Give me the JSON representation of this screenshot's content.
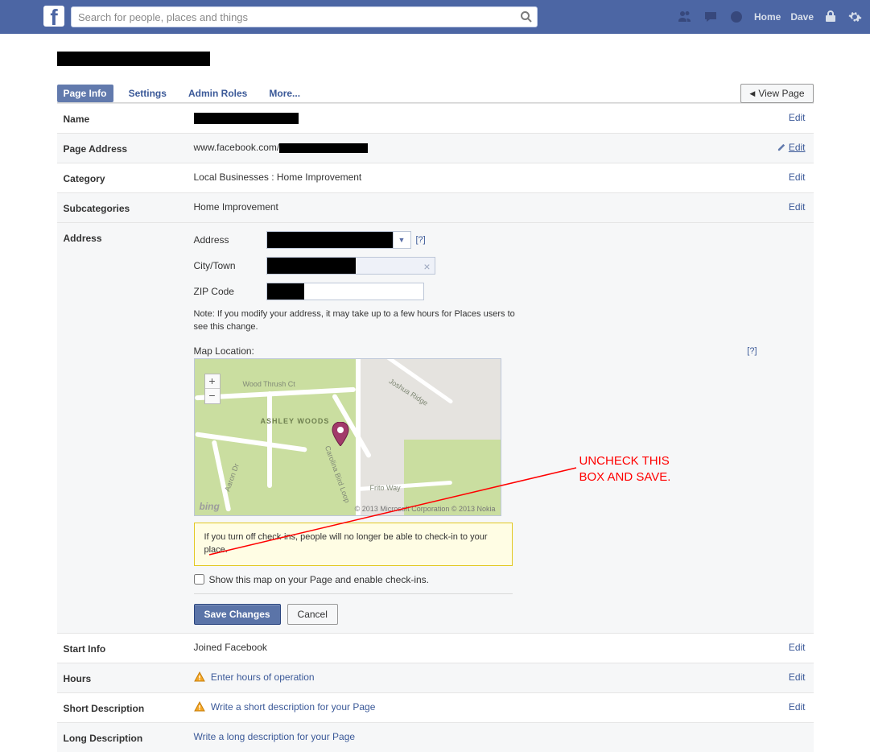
{
  "topbar": {
    "search_placeholder": "Search for people, places and things",
    "home": "Home",
    "user": "Dave"
  },
  "page": {
    "view_page": "View Page",
    "tabs": [
      "Page Info",
      "Settings",
      "Admin Roles",
      "More..."
    ]
  },
  "rows": {
    "name": {
      "label": "Name",
      "edit": "Edit"
    },
    "page_address": {
      "label": "Page Address",
      "value_prefix": "www.facebook.com/",
      "edit": "Edit"
    },
    "category": {
      "label": "Category",
      "value": "Local Businesses : Home Improvement",
      "edit": "Edit"
    },
    "subcategories": {
      "label": "Subcategories",
      "value": "Home Improvement",
      "edit": "Edit"
    },
    "address": {
      "label": "Address"
    },
    "start_info": {
      "label": "Start Info",
      "value": "Joined Facebook",
      "edit": "Edit"
    },
    "hours": {
      "label": "Hours",
      "value": "Enter hours of operation",
      "edit": "Edit"
    },
    "short_desc": {
      "label": "Short Description",
      "value": "Write a short description for your Page",
      "edit": "Edit"
    },
    "long_desc": {
      "label": "Long Description",
      "value": "Write a long description for your Page"
    }
  },
  "addr": {
    "address_label": "Address",
    "city_label": "City/Town",
    "zip_label": "ZIP Code",
    "help": "[?]",
    "note": "Note: If you modify your address, it may take up to a few hours for Places users to see this change.",
    "map_label": "Map Location:",
    "map_copy": "© 2013 Microsoft Corporation     © 2013 Nokia",
    "bing": "bing",
    "warning": "If you turn off check-ins, people will no longer be able to check-in to your place.",
    "checkbox": "Show this map on your Page and enable check-ins.",
    "save": "Save Changes",
    "cancel": "Cancel",
    "roads": {
      "wood_thrush": "Wood Thrush Ct",
      "ashley": "ASHLEY WOODS",
      "aaron": "Aaron Dr",
      "carolina": "Carolina Bird Loop",
      "frito": "Frito Way",
      "joshua": "Joshua Ridge"
    }
  },
  "annotation": {
    "line1": "UNCHECK THIS",
    "line2": "BOX AND SAVE."
  }
}
